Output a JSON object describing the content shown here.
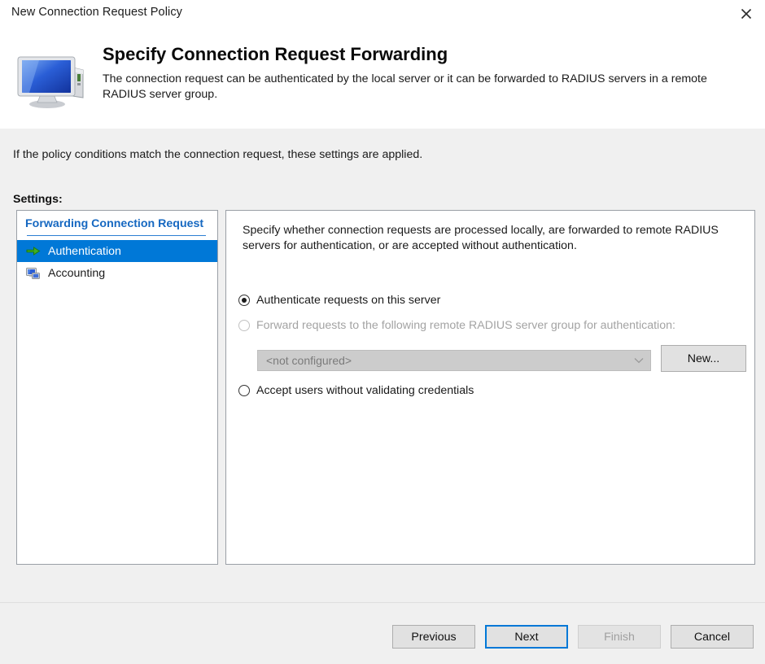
{
  "window": {
    "title": "New Connection Request Policy",
    "close_icon": "close-icon"
  },
  "banner": {
    "icon": "computer-monitor-icon",
    "title": "Specify Connection Request Forwarding",
    "description": "The connection request can be authenticated by the local server or it can be forwarded to RADIUS servers in a remote RADIUS server group."
  },
  "body": {
    "intro": "If the policy conditions match the connection request, these settings are applied.",
    "settings_label": "Settings:"
  },
  "tree": {
    "group_label": "Forwarding Connection Request",
    "items": [
      {
        "label": "Authentication",
        "icon": "green-arrow-icon",
        "selected": true
      },
      {
        "label": "Accounting",
        "icon": "network-computers-icon",
        "selected": false
      }
    ]
  },
  "content": {
    "description": "Specify whether connection requests are processed locally, are forwarded to remote RADIUS servers for authentication, or are accepted without authentication.",
    "options": [
      {
        "label": "Authenticate requests on this server",
        "checked": true,
        "disabled": false
      },
      {
        "label": "Forward requests to the following remote RADIUS server group for authentication:",
        "checked": false,
        "disabled": true
      },
      {
        "label": "Accept users without validating credentials",
        "checked": false,
        "disabled": false
      }
    ],
    "server_group_combo": {
      "value": "<not configured>",
      "disabled": true,
      "chevron_icon": "chevron-down-icon"
    },
    "new_button": "New..."
  },
  "footer": {
    "buttons": [
      {
        "label": "Previous",
        "state": "normal"
      },
      {
        "label": "Next",
        "state": "focused"
      },
      {
        "label": "Finish",
        "state": "disabled"
      },
      {
        "label": "Cancel",
        "state": "normal"
      }
    ]
  },
  "colors": {
    "accent": "#0078d7",
    "group_header": "#1668c1",
    "body_bg": "#f0f0f0",
    "panel_bg": "#ffffff"
  }
}
